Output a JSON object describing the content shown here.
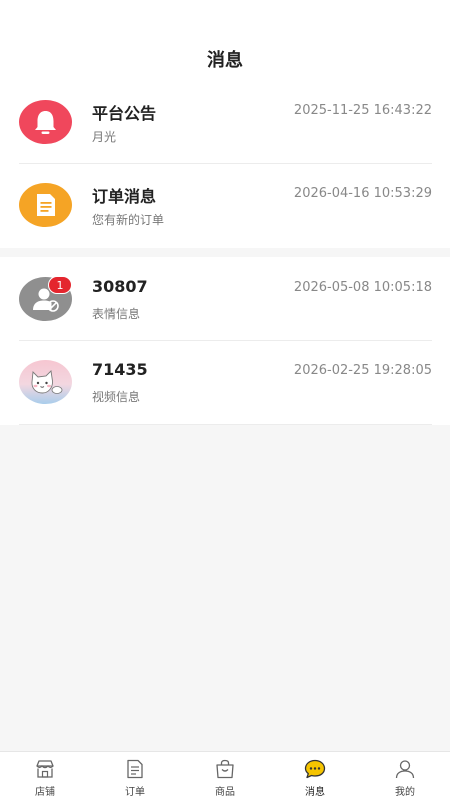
{
  "page": {
    "title": "消息"
  },
  "messages": [
    {
      "name": "平台公告",
      "subtitle": "月光",
      "time": "2025-11-25 16:43:22",
      "icon": "bell-icon",
      "color": "#f0475c"
    },
    {
      "name": "订单消息",
      "subtitle": "您有新的订单",
      "time": "2026-04-16 10:53:29",
      "icon": "document-icon",
      "color": "#f5a425"
    }
  ],
  "chats": [
    {
      "name": "30807",
      "subtitle": "表情信息",
      "time": "2026-05-08 10:05:18",
      "icon": "default-user-avatar-icon",
      "badge": "1",
      "color": "#8f8f8f"
    },
    {
      "name": "71435",
      "subtitle": "视频信息",
      "time": "2026-02-25 19:28:05",
      "icon": "cat-avatar-icon"
    }
  ],
  "tabbar": {
    "items": [
      {
        "label": "店铺",
        "icon": "store-icon"
      },
      {
        "label": "订单",
        "icon": "order-icon"
      },
      {
        "label": "商品",
        "icon": "bag-icon"
      },
      {
        "label": "消息",
        "icon": "chat-bubble-icon",
        "active": true,
        "accent": "#f5c400"
      },
      {
        "label": "我的",
        "icon": "user-icon"
      }
    ]
  }
}
